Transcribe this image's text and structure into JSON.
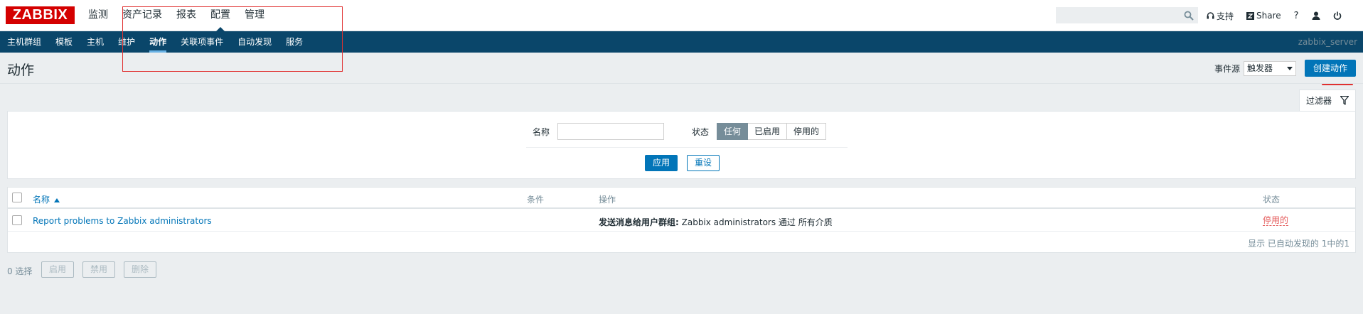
{
  "header": {
    "logo": "ZABBIX",
    "menu": [
      {
        "label": "监测",
        "selected": false
      },
      {
        "label": "资产记录",
        "selected": false
      },
      {
        "label": "报表",
        "selected": false
      },
      {
        "label": "配置",
        "selected": true
      },
      {
        "label": "管理",
        "selected": false
      }
    ],
    "search_placeholder": "",
    "support_label": "支持",
    "share_label": "Share",
    "help_label": "?"
  },
  "subnav": {
    "items": [
      "主机群组",
      "模板",
      "主机",
      "维护",
      "动作",
      "关联项事件",
      "自动发现",
      "服务"
    ],
    "active": "动作",
    "server_name": "zabbix_server"
  },
  "page": {
    "title": "动作",
    "event_source_label": "事件源",
    "event_source_value": "触发器",
    "create_button": "创建动作"
  },
  "filter": {
    "tab_label": "过滤器",
    "name_label": "名称",
    "name_value": "",
    "status_label": "状态",
    "status_options": [
      "任何",
      "已启用",
      "停用的"
    ],
    "status_selected": "任何",
    "apply_label": "应用",
    "reset_label": "重设"
  },
  "table": {
    "columns": {
      "name": "名称",
      "conditions": "条件",
      "operations": "操作",
      "status": "状态"
    },
    "sort_column": "名称",
    "sort_direction": "asc",
    "rows": [
      {
        "name": "Report problems to Zabbix administrators",
        "conditions": "",
        "operation_prefix": "发送消息给用户群组:",
        "operation_text": " Zabbix administrators 通过 所有介质",
        "status": "停用的"
      }
    ],
    "paging": "显示 已自动发现的 1中的1"
  },
  "footer": {
    "selected_count": "0 选择",
    "enable_label": "启用",
    "disable_label": "禁用",
    "delete_label": "删除"
  },
  "colors": {
    "brand": "#d40000",
    "subnav_bg": "#0a466a",
    "accent": "#0275b8",
    "disabled_status": "#e45959",
    "annotation": "#e03030"
  }
}
